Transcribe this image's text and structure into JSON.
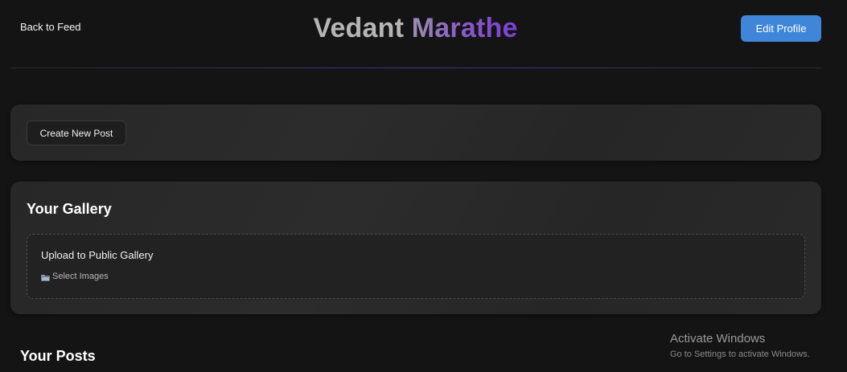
{
  "header": {
    "back_label": "Back to Feed",
    "title_first": "Vedant",
    "title_last": "Marathe",
    "edit_profile_label": "Edit Profile"
  },
  "create_card": {
    "create_post_label": "Create New Post"
  },
  "gallery": {
    "heading": "Your Gallery",
    "upload_title": "Upload to Public Gallery",
    "select_images_label": "Select Images",
    "select_images_icon": "folder-icon"
  },
  "posts": {
    "heading": "Your Posts"
  },
  "watermark": {
    "title": "Activate Windows",
    "subtitle": "Go to Settings to activate Windows."
  },
  "colors": {
    "background": "#141414",
    "card": "#2a2a2a",
    "accent_button": "#3f86d8",
    "title_gradient_start": "#9b8fb0",
    "title_gradient_end": "#7a3fd6"
  }
}
